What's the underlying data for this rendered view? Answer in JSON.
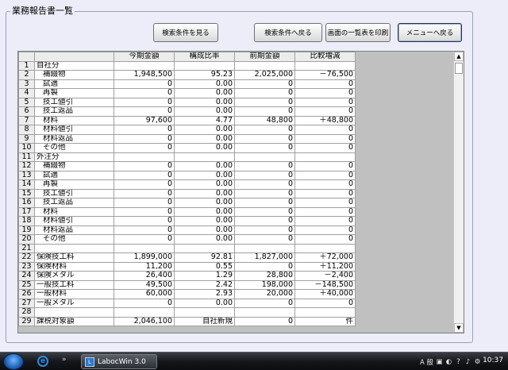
{
  "group_title": "業務報告書一覧",
  "buttons": {
    "view_criteria": "検索条件を見る",
    "back_to_criteria": "検索条件へ戻る",
    "print_list": "画面の一覧表を印刷",
    "back_to_menu": "メニューへ戻る"
  },
  "columns": [
    "",
    "",
    "今期金額",
    "構成比率",
    "前期金額",
    "比較増減"
  ],
  "rows": [
    {
      "n": "1",
      "label": "自社分",
      "indent": false,
      "c1": "",
      "c2": "",
      "c3": "",
      "c4": ""
    },
    {
      "n": "2",
      "label": "補綴物",
      "indent": true,
      "c1": "1,948,500",
      "c2": "95.23",
      "c3": "2,025,000",
      "c4": "－76,500"
    },
    {
      "n": "3",
      "label": "試適",
      "indent": true,
      "c1": "0",
      "c2": "0.00",
      "c3": "0",
      "c4": "0"
    },
    {
      "n": "4",
      "label": "再製",
      "indent": true,
      "c1": "0",
      "c2": "0.00",
      "c3": "0",
      "c4": "0"
    },
    {
      "n": "5",
      "label": "技工値引",
      "indent": true,
      "c1": "0",
      "c2": "0.00",
      "c3": "0",
      "c4": "0"
    },
    {
      "n": "6",
      "label": "技工返品",
      "indent": true,
      "c1": "0",
      "c2": "0.00",
      "c3": "0",
      "c4": "0"
    },
    {
      "n": "7",
      "label": "材料",
      "indent": true,
      "c1": "97,600",
      "c2": "4.77",
      "c3": "48,800",
      "c4": "＋48,800"
    },
    {
      "n": "8",
      "label": "材料値引",
      "indent": true,
      "c1": "0",
      "c2": "0.00",
      "c3": "0",
      "c4": "0"
    },
    {
      "n": "9",
      "label": "材料返品",
      "indent": true,
      "c1": "0",
      "c2": "0.00",
      "c3": "0",
      "c4": "0"
    },
    {
      "n": "10",
      "label": "その他",
      "indent": true,
      "c1": "0",
      "c2": "0.00",
      "c3": "0",
      "c4": "0"
    },
    {
      "n": "11",
      "label": "外注分",
      "indent": false,
      "c1": "",
      "c2": "",
      "c3": "",
      "c4": ""
    },
    {
      "n": "12",
      "label": "補綴物",
      "indent": true,
      "c1": "0",
      "c2": "0.00",
      "c3": "0",
      "c4": "0"
    },
    {
      "n": "13",
      "label": "試適",
      "indent": true,
      "c1": "0",
      "c2": "0.00",
      "c3": "0",
      "c4": "0"
    },
    {
      "n": "14",
      "label": "再製",
      "indent": true,
      "c1": "0",
      "c2": "0.00",
      "c3": "0",
      "c4": "0"
    },
    {
      "n": "15",
      "label": "技工値引",
      "indent": true,
      "c1": "0",
      "c2": "0.00",
      "c3": "0",
      "c4": "0"
    },
    {
      "n": "16",
      "label": "技工返品",
      "indent": true,
      "c1": "0",
      "c2": "0.00",
      "c3": "0",
      "c4": "0"
    },
    {
      "n": "17",
      "label": "材料",
      "indent": true,
      "c1": "0",
      "c2": "0.00",
      "c3": "0",
      "c4": "0"
    },
    {
      "n": "18",
      "label": "材料値引",
      "indent": true,
      "c1": "0",
      "c2": "0.00",
      "c3": "0",
      "c4": "0"
    },
    {
      "n": "19",
      "label": "材料返品",
      "indent": true,
      "c1": "0",
      "c2": "0.00",
      "c3": "0",
      "c4": "0"
    },
    {
      "n": "20",
      "label": "その他",
      "indent": true,
      "c1": "0",
      "c2": "0.00",
      "c3": "0",
      "c4": "0"
    },
    {
      "n": "21",
      "label": "",
      "indent": false,
      "c1": "",
      "c2": "",
      "c3": "",
      "c4": ""
    },
    {
      "n": "22",
      "label": "保険技工料",
      "indent": false,
      "c1": "1,899,000",
      "c2": "92.81",
      "c3": "1,827,000",
      "c4": "＋72,000"
    },
    {
      "n": "23",
      "label": "保険材料",
      "indent": false,
      "c1": "11,200",
      "c2": "0.55",
      "c3": "0",
      "c4": "＋11,200"
    },
    {
      "n": "24",
      "label": "保険メタル",
      "indent": false,
      "c1": "26,400",
      "c2": "1.29",
      "c3": "28,800",
      "c4": "－2,400"
    },
    {
      "n": "25",
      "label": "一般技工料",
      "indent": false,
      "c1": "49,500",
      "c2": "2.42",
      "c3": "198,000",
      "c4": "－148,500"
    },
    {
      "n": "26",
      "label": "一般材料",
      "indent": false,
      "c1": "60,000",
      "c2": "2.93",
      "c3": "20,000",
      "c4": "＋40,000"
    },
    {
      "n": "27",
      "label": "一般メタル",
      "indent": false,
      "c1": "0",
      "c2": "0.00",
      "c3": "0",
      "c4": "0"
    },
    {
      "n": "28",
      "label": "",
      "indent": false,
      "c1": "",
      "c2": "",
      "c3": "",
      "c4": ""
    },
    {
      "n": "29",
      "label": "課税対象額",
      "indent": false,
      "c1": "2,046,100",
      "c2": "自社新規",
      "c3": "0",
      "c4": "件"
    }
  ],
  "taskbar": {
    "task_label": "LabocWin 3.0",
    "tray_ime": "A 般",
    "clock": "10:37"
  }
}
